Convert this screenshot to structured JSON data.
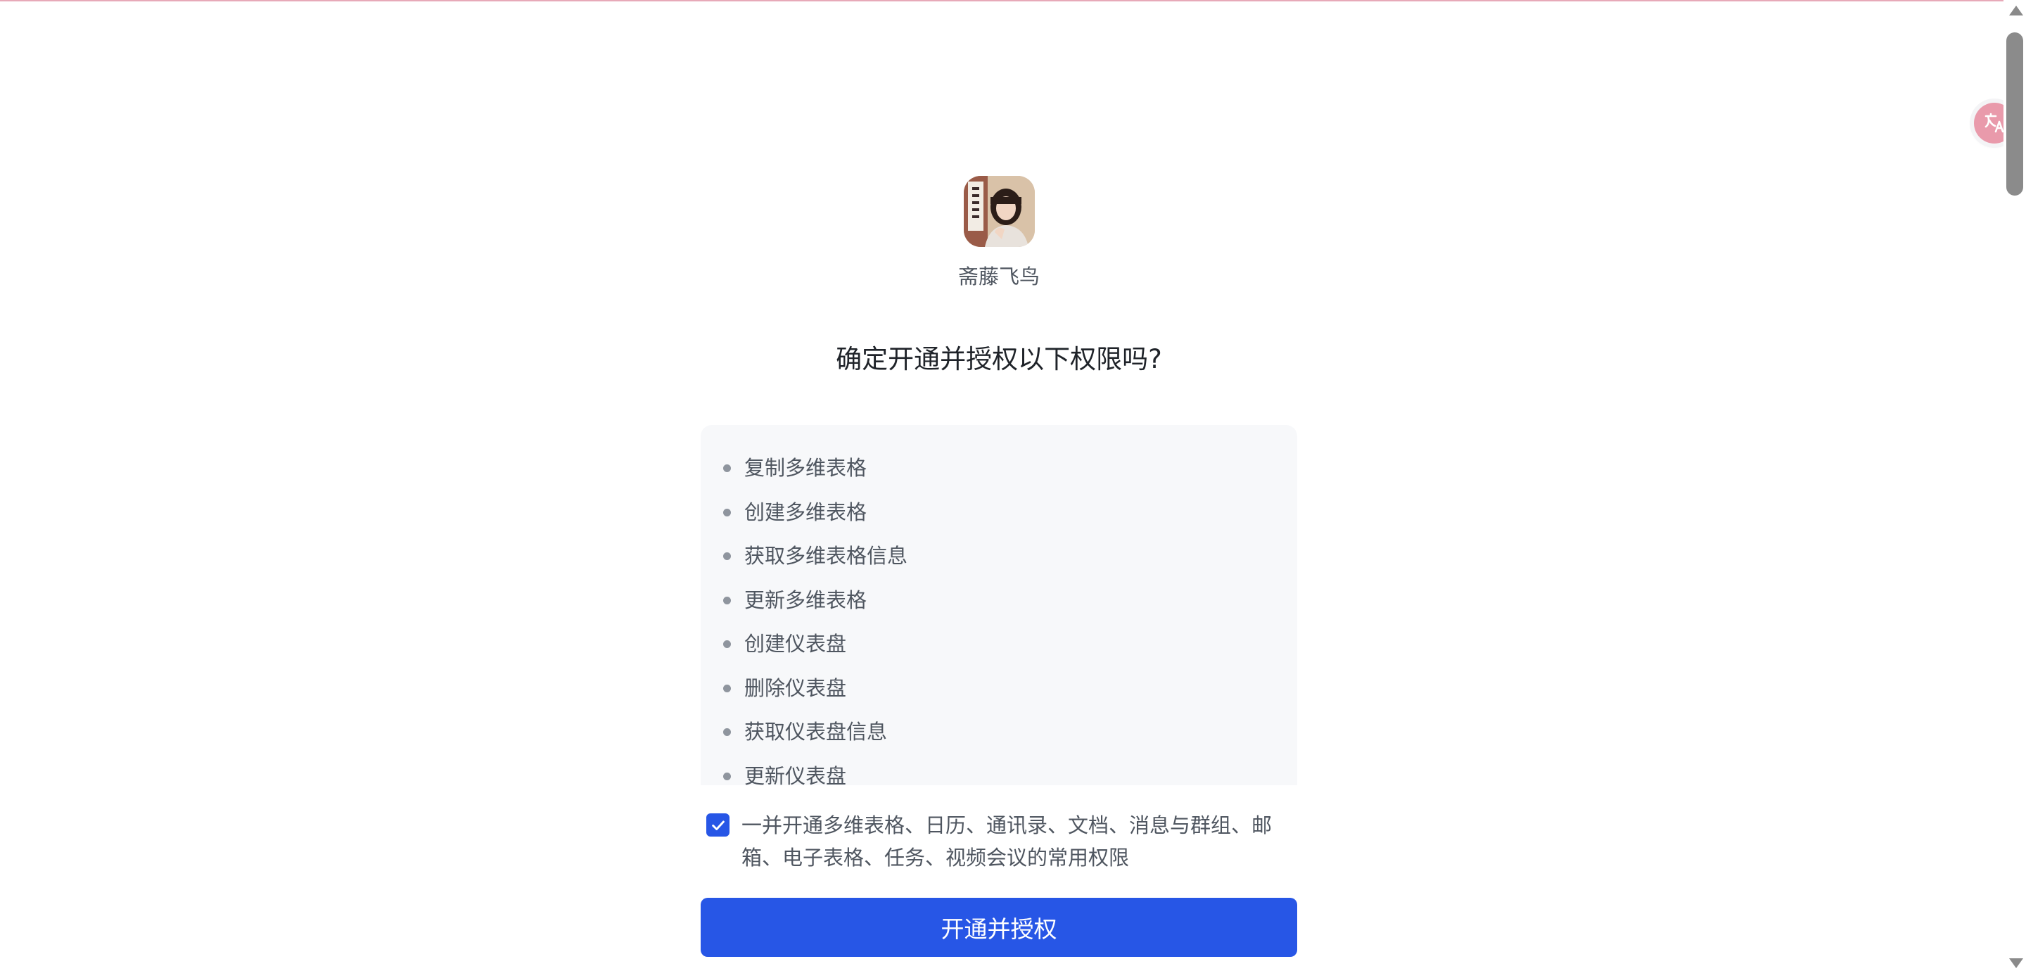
{
  "user": {
    "name": "斋藤飞鸟",
    "avatar_icon": "user-avatar-photo"
  },
  "title": "确定开通并授权以下权限吗?",
  "permissions": [
    "复制多维表格",
    "创建多维表格",
    "获取多维表格信息",
    "更新多维表格",
    "创建仪表盘",
    "删除仪表盘",
    "获取仪表盘信息",
    "更新仪表盘"
  ],
  "consent": {
    "checked": true,
    "text": "一并开通多维表格、日历、通讯录、文档、消息与群组、邮箱、电子表格、任务、视频会议的常用权限"
  },
  "primary_button": {
    "label": "开通并授权"
  },
  "colors": {
    "accent": "#2756e6",
    "list_background": "#f7f8fa",
    "translate_fab": "#e99aab"
  },
  "icons": {
    "checkbox": "checkmark-icon",
    "translate": "translate-icon",
    "scroll_up": "scroll-up-arrow-icon",
    "scroll_down": "scroll-down-arrow-icon"
  }
}
